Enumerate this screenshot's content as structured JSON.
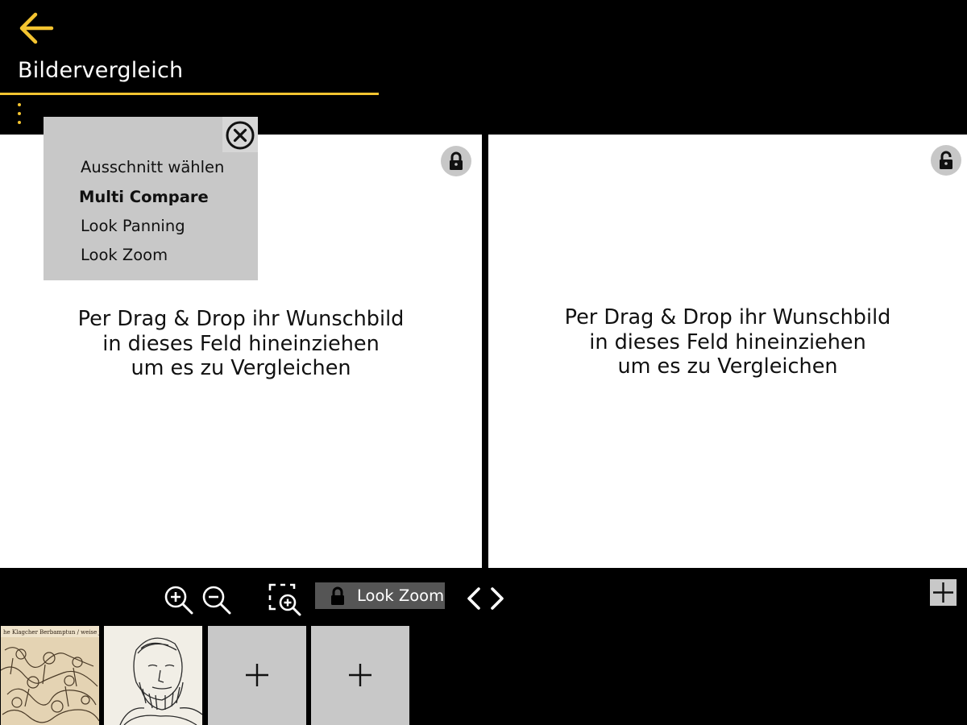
{
  "header": {
    "title": "Bildervergleich",
    "accent_color": "#f4c430",
    "back_icon": "arrow-left-icon",
    "menu_icon": "kebab-menu-icon"
  },
  "menu": {
    "close_icon": "close-circle-icon",
    "items": [
      {
        "label": "Ausschnitt wählen",
        "bold": false
      },
      {
        "label": "Multi Compare",
        "bold": true
      },
      {
        "label": "Look Panning",
        "bold": false
      },
      {
        "label": "Look Zoom",
        "bold": false
      }
    ]
  },
  "panels": {
    "left": {
      "drop_lines": [
        "Per Drag & Drop ihr Wunschbild",
        "in dieses Feld hineinziehen",
        "um es zu Vergleichen"
      ],
      "lock_state": "locked"
    },
    "right": {
      "drop_lines": [
        "Per Drag & Drop ihr Wunschbild",
        "in dieses Feld hineinziehen",
        "um es zu Vergleichen"
      ],
      "lock_state": "unlocked"
    }
  },
  "toolbar": {
    "zoom_in_icon": "zoom-in-icon",
    "zoom_out_icon": "zoom-out-icon",
    "region_zoom_icon": "region-zoom-icon",
    "look_zoom_label": "Look Zoom",
    "look_zoom_icon": "lock-icon",
    "prev_icon": "chevron-left-icon",
    "next_icon": "chevron-right-icon",
    "add_panel_icon": "plus-icon"
  },
  "thumbnails": [
    {
      "type": "image",
      "caption": "he Klagcher Berbamptun / weise jammer kreuchleuthe"
    },
    {
      "type": "image"
    },
    {
      "type": "add"
    },
    {
      "type": "add"
    }
  ]
}
